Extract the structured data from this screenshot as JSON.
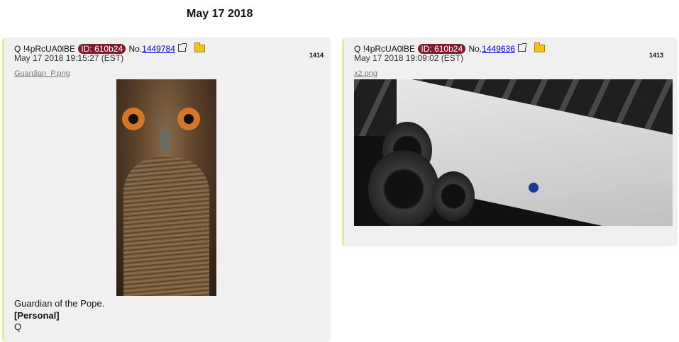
{
  "page": {
    "date_header": "May 17 2018"
  },
  "posts": [
    {
      "author": "Q",
      "tripcode": "!4pRcUA0lBE",
      "id_label": "ID: 610b24",
      "no_prefix": "No.",
      "post_no": "1449784",
      "timestamp": "May 17 2018 19:15:27 (EST)",
      "count": "1414",
      "filename": "Guardian_P.png",
      "lines": [
        "Guardian of the Pope.",
        "[Personal]",
        "Q"
      ]
    },
    {
      "author": "Q",
      "tripcode": "!4pRcUA0lBE",
      "id_label": "ID: 610b24",
      "no_prefix": "No.",
      "post_no": "1449636",
      "timestamp": "May 17 2018 19:09:02 (EST)",
      "count": "1413",
      "filename": "x2.png"
    }
  ],
  "colors": {
    "id_badge": "#7a1c2e",
    "link": "#0000cc",
    "post_bg": "#f0f0f0"
  },
  "icons": [
    "external-link-icon",
    "folder-icon"
  ]
}
